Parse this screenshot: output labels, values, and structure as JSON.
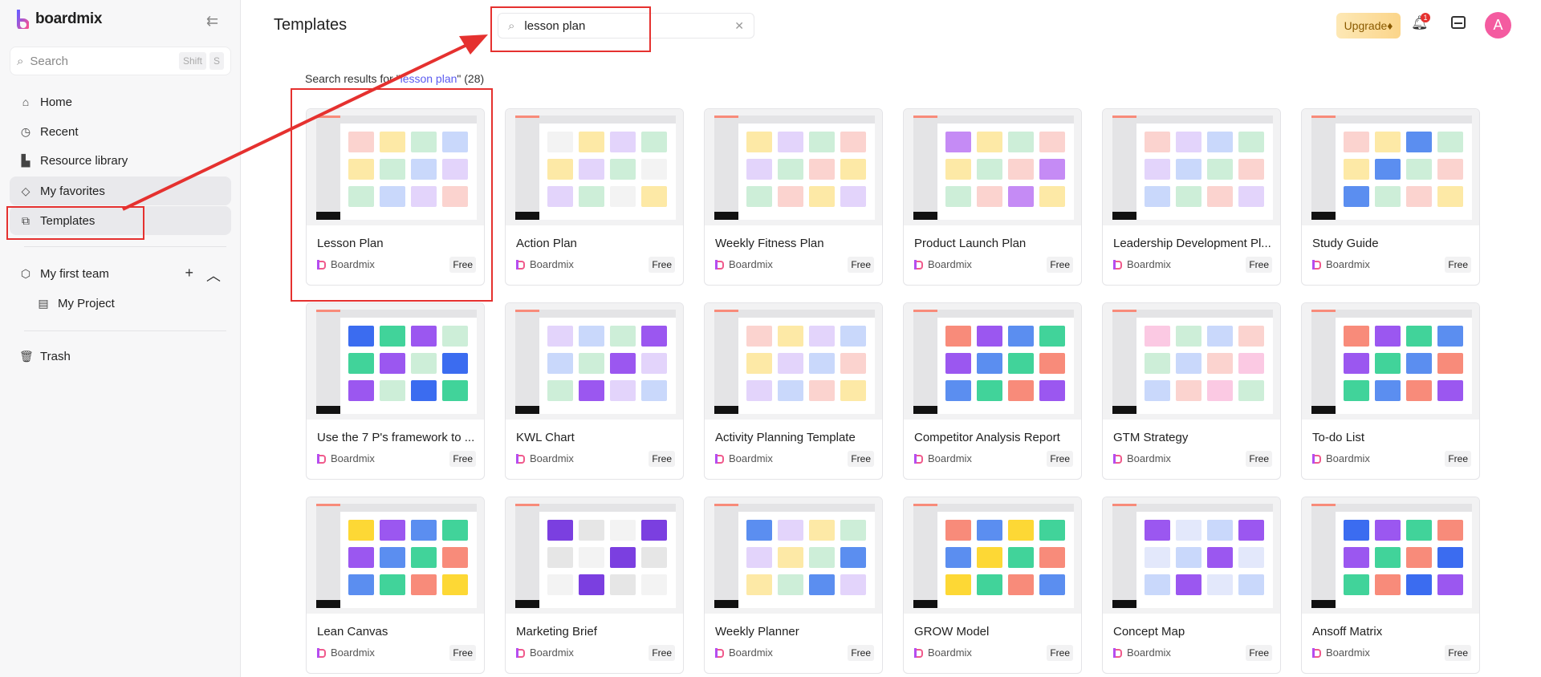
{
  "brand": {
    "name": "boardmix"
  },
  "sidebar": {
    "search": {
      "placeholder": "Search",
      "shortcut_1": "Shift",
      "shortcut_2": "S"
    },
    "items": [
      {
        "label": "Home",
        "icon": "home-icon"
      },
      {
        "label": "Recent",
        "icon": "clock-icon"
      },
      {
        "label": "Resource library",
        "icon": "library-icon"
      },
      {
        "label": "My favorites",
        "icon": "tag-icon"
      },
      {
        "label": "Templates",
        "icon": "templates-icon"
      }
    ],
    "team": {
      "label": "My first team",
      "project": "My Project"
    },
    "trash": "Trash"
  },
  "header": {
    "title": "Templates",
    "search_value": "lesson plan",
    "upgrade": "Upgrade",
    "notification_count": "1",
    "avatar": "A"
  },
  "results": {
    "prefix": "Search results for \"",
    "query": "lesson plan",
    "suffix": "\" (28)"
  },
  "colors": {
    "accent": "#5b5bf0",
    "annotation": "#e5312f",
    "avatar": "#f45ba0"
  },
  "cards": [
    {
      "title": "Lesson Plan",
      "author": "Boardmix",
      "badge": "Free",
      "thumb_colors": [
        "#fbd3cf",
        "#fde9a6",
        "#cdeed8",
        "#c9d8fb",
        "#e3d4fb"
      ]
    },
    {
      "title": "Action Plan",
      "author": "Boardmix",
      "badge": "Free",
      "thumb_colors": [
        "#f3f3f3",
        "#fde9a6",
        "#e3d4fb",
        "#cdeed8"
      ]
    },
    {
      "title": "Weekly Fitness Plan",
      "author": "Boardmix",
      "badge": "Free",
      "thumb_colors": [
        "#fde9a6",
        "#e3d4fb",
        "#cdeed8",
        "#fbd3cf"
      ]
    },
    {
      "title": "Product Launch Plan",
      "author": "Boardmix",
      "badge": "Free",
      "thumb_colors": [
        "#c58bf5",
        "#fde9a6",
        "#cdeed8",
        "#fbd3cf"
      ]
    },
    {
      "title": "Leadership Development Pl...",
      "author": "Boardmix",
      "badge": "Free",
      "thumb_colors": [
        "#fbd3cf",
        "#e3d4fb",
        "#c9d8fb",
        "#cdeed8"
      ]
    },
    {
      "title": "Study Guide",
      "author": "Boardmix",
      "badge": "Free",
      "thumb_colors": [
        "#fbd3cf",
        "#fde9a6",
        "#5b8ef0",
        "#cdeed8"
      ]
    },
    {
      "title": "Use the 7 P's framework to ...",
      "author": "Boardmix",
      "badge": "Free",
      "thumb_colors": [
        "#3b6cf0",
        "#41d39a",
        "#9b57f0",
        "#cdeed8"
      ]
    },
    {
      "title": "KWL Chart",
      "author": "Boardmix",
      "badge": "Free",
      "thumb_colors": [
        "#e3d4fb",
        "#c9d8fb",
        "#cdeed8",
        "#9b57f0"
      ]
    },
    {
      "title": "Activity Planning Template",
      "author": "Boardmix",
      "badge": "Free",
      "thumb_colors": [
        "#fbd3cf",
        "#fde9a6",
        "#e3d4fb",
        "#c9d8fb"
      ]
    },
    {
      "title": "Competitor Analysis Report",
      "author": "Boardmix",
      "badge": "Free",
      "thumb_colors": [
        "#f88b7a",
        "#9b57f0",
        "#5b8ef0",
        "#41d39a"
      ]
    },
    {
      "title": "GTM Strategy",
      "author": "Boardmix",
      "badge": "Free",
      "thumb_colors": [
        "#fbc9e3",
        "#cdeed8",
        "#c9d8fb",
        "#fbd3cf"
      ]
    },
    {
      "title": "To-do List",
      "author": "Boardmix",
      "badge": "Free",
      "thumb_colors": [
        "#f88b7a",
        "#9b57f0",
        "#41d39a",
        "#5b8ef0"
      ]
    },
    {
      "title": "Lean Canvas",
      "author": "Boardmix",
      "badge": "Free",
      "thumb_colors": [
        "#fdd835",
        "#9b57f0",
        "#5b8ef0",
        "#41d39a",
        "#f88b7a"
      ]
    },
    {
      "title": "Marketing Brief",
      "author": "Boardmix",
      "badge": "Free",
      "thumb_colors": [
        "#7b3fe0",
        "#e6e6e6",
        "#f3f3f3"
      ]
    },
    {
      "title": "Weekly Planner",
      "author": "Boardmix",
      "badge": "Free",
      "thumb_colors": [
        "#5b8ef0",
        "#e3d4fb",
        "#fde9a6",
        "#cdeed8"
      ]
    },
    {
      "title": "GROW Model",
      "author": "Boardmix",
      "badge": "Free",
      "thumb_colors": [
        "#f88b7a",
        "#5b8ef0",
        "#fdd835",
        "#41d39a"
      ]
    },
    {
      "title": "Concept Map",
      "author": "Boardmix",
      "badge": "Free",
      "thumb_colors": [
        "#9b57f0",
        "#e3e8fb",
        "#c9d8fb"
      ]
    },
    {
      "title": "Ansoff Matrix",
      "author": "Boardmix",
      "badge": "Free",
      "thumb_colors": [
        "#3b6cf0",
        "#9b57f0",
        "#41d39a",
        "#f88b7a"
      ]
    }
  ]
}
